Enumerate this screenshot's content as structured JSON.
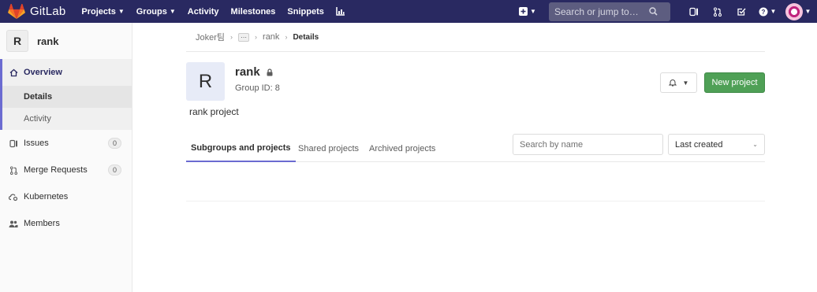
{
  "navbar": {
    "brand": "GitLab",
    "links": [
      {
        "label": "Projects",
        "dropdown": true
      },
      {
        "label": "Groups",
        "dropdown": true
      },
      {
        "label": "Activity",
        "dropdown": false
      },
      {
        "label": "Milestones",
        "dropdown": false
      },
      {
        "label": "Snippets",
        "dropdown": false
      }
    ],
    "search_placeholder": "Search or jump to…"
  },
  "sidebar": {
    "group_initial": "R",
    "group_name": "rank",
    "overview_label": "Overview",
    "sub_items": [
      "Details",
      "Activity"
    ],
    "items": [
      {
        "label": "Issues",
        "count": "0"
      },
      {
        "label": "Merge Requests",
        "count": "0"
      },
      {
        "label": "Kubernetes"
      },
      {
        "label": "Members"
      }
    ]
  },
  "breadcrumb": {
    "root": "Joker팀",
    "more": "···",
    "group": "rank",
    "current": "Details"
  },
  "group": {
    "initial": "R",
    "name": "rank",
    "id_label": "Group ID: 8",
    "description": "rank project"
  },
  "actions": {
    "new_project": "New project"
  },
  "tabs": [
    "Subgroups and projects",
    "Shared projects",
    "Archived projects"
  ],
  "filter": {
    "placeholder": "Search by name",
    "sort_value": "Last created"
  }
}
